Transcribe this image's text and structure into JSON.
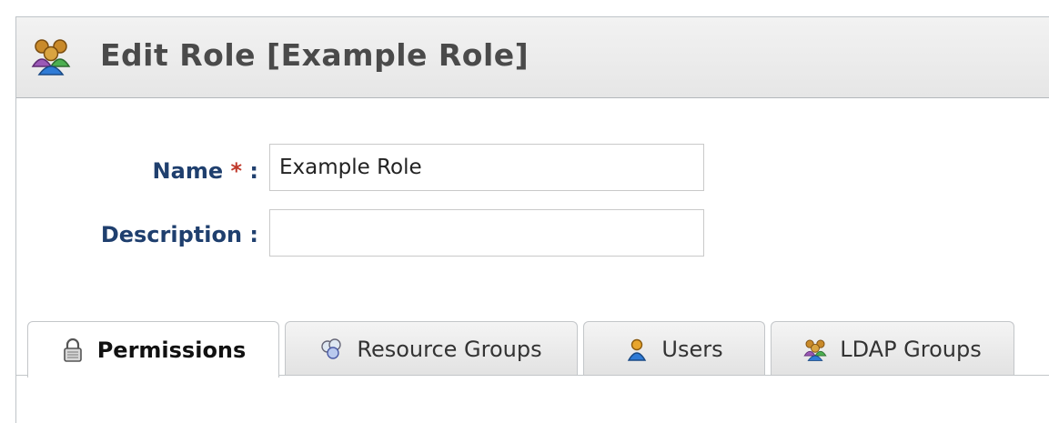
{
  "header": {
    "title": "Edit Role [Example Role]",
    "icon": "group-icon"
  },
  "form": {
    "name_label": "Name",
    "required_marker": "*",
    "name_colon": ":",
    "name_value": "Example Role",
    "description_label": "Description :",
    "description_value": ""
  },
  "tabs": [
    {
      "label": "Permissions",
      "icon": "lock-icon",
      "active": true
    },
    {
      "label": "Resource Groups",
      "icon": "resource-groups-icon",
      "active": false
    },
    {
      "label": "Users",
      "icon": "user-icon",
      "active": false
    },
    {
      "label": "LDAP Groups",
      "icon": "group-icon",
      "active": false
    }
  ],
  "colors": {
    "label_blue": "#1f3f6e",
    "required_red": "#c0392b",
    "header_bg": "#e6e6e6"
  }
}
